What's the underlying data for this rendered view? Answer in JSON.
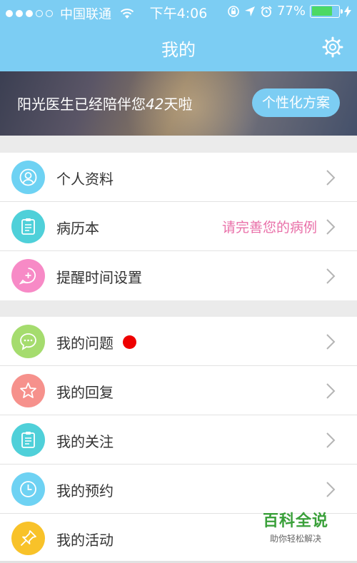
{
  "status": {
    "carrier": "中国联通",
    "time": "下午4:06",
    "battery": "77%"
  },
  "header": {
    "title": "我的"
  },
  "banner": {
    "text_prefix": "阳光医生已经陪伴您",
    "days": "42",
    "text_suffix": "天啦",
    "button": "个性化方案"
  },
  "group1": [
    {
      "label": "个人资料",
      "icon": "profile-icon",
      "color": "#6ed2f3"
    },
    {
      "label": "病历本",
      "icon": "clipboard-icon",
      "color": "#4fd0d9",
      "hint": "请完善您的病例"
    },
    {
      "label": "提醒时间设置",
      "icon": "reminder-icon",
      "color": "#f78ac6"
    }
  ],
  "group2": [
    {
      "label": "我的问题",
      "icon": "chat-icon",
      "color": "#a5dc6e"
    },
    {
      "label": "我的回复",
      "icon": "star-icon",
      "color": "#f6918c"
    },
    {
      "label": "我的关注",
      "icon": "clipboard-icon",
      "color": "#4fd0d9"
    },
    {
      "label": "我的预约",
      "icon": "clock-icon",
      "color": "#6ed2f3"
    },
    {
      "label": "我的活动",
      "icon": "pin-icon",
      "color": "#f8c229"
    }
  ],
  "watermark": {
    "title": "百科全说",
    "subtitle": "助你轻松解决"
  }
}
